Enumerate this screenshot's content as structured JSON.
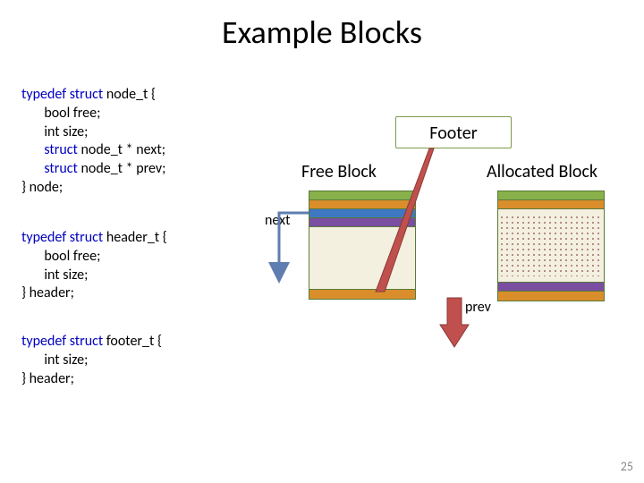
{
  "title": "Example Blocks",
  "code": {
    "node_t": {
      "l1_pre": "typedef struct ",
      "l1_name": "node_t",
      "l1_post": " {",
      "l2": "bool free;",
      "l3": "int size;",
      "l4_pre": "struct ",
      "l4_name": "node_t",
      "l4_post": " * next;",
      "l5_pre": "struct ",
      "l5_name": "node_t",
      "l5_post": " * prev;",
      "l6": "} node;"
    },
    "header_t": {
      "l1_pre": "typedef struct ",
      "l1_name": "header_t",
      "l1_post": " {",
      "l2": "bool free;",
      "l3": "int size;",
      "l4": "} header;"
    },
    "footer_t": {
      "l1_pre": "typedef struct ",
      "l1_name": "footer_t",
      "l1_post": " {",
      "l2": "int size;",
      "l3": "} header;"
    }
  },
  "labels": {
    "footer": "Footer",
    "free_block": "Free Block",
    "allocated_block": "Allocated Block",
    "next": "next",
    "prev": "prev"
  },
  "colors": {
    "green": "#88b04b",
    "orange": "#d98e2b",
    "blue": "#3e78c2",
    "purple": "#7a4ea0",
    "ivory": "#f4f0df",
    "arrow_red": "#c0504d",
    "arrow_blue": "#5f7db0"
  },
  "page_number": "25"
}
